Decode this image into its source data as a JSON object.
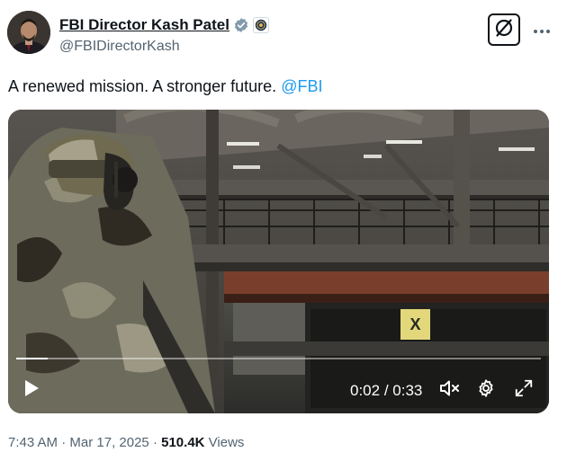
{
  "author": {
    "display_name": "FBI Director Kash Patel",
    "handle": "@FBIDirectorKash"
  },
  "tweet": {
    "text": "A renewed mission. A stronger future.",
    "mention": "@FBI"
  },
  "video": {
    "current_time": "0:02",
    "separator": "/",
    "duration": "0:33",
    "progress": 0.06,
    "warning_sign": "X"
  },
  "meta": {
    "time": "7:43 AM",
    "dot1": "·",
    "date": "Mar 17, 2025",
    "dot2": "·",
    "views_count": "510.4K",
    "views_label": "Views"
  },
  "icons": {
    "verified": "verified-badge-icon",
    "agency": "fbi-seal-icon",
    "grok": "grok-icon",
    "more": "more-icon",
    "play": "play-icon",
    "mute": "mute-icon",
    "settings": "gear-icon",
    "fullscreen": "fullscreen-icon"
  },
  "colors": {
    "accent": "#1d9bf0",
    "verified": "#829aab",
    "text": "#0f1419",
    "muted": "#536471"
  }
}
